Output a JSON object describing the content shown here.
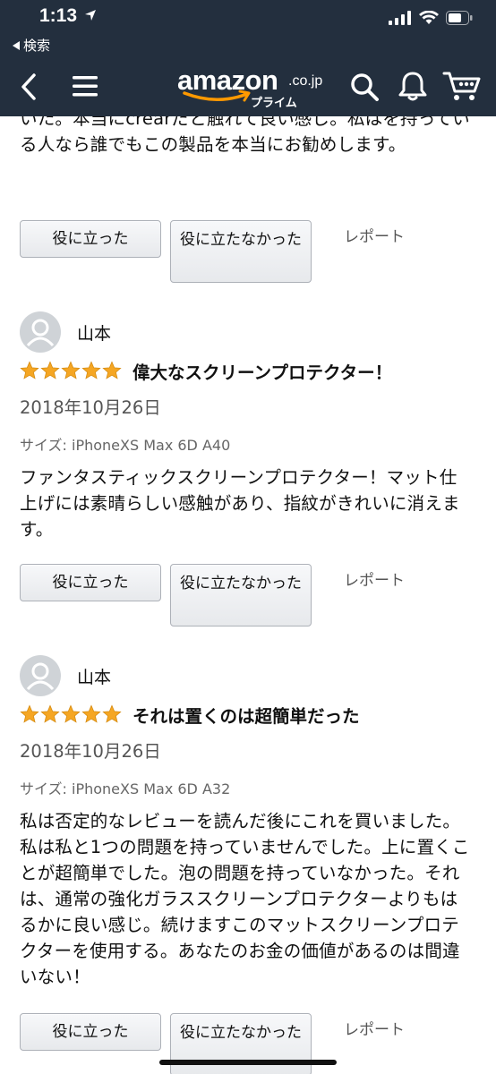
{
  "status_bar": {
    "time": "1:13",
    "back_app": "検索"
  },
  "header": {
    "logo_main": "amazon",
    "logo_domain": ".co.jp",
    "logo_sub": "プライム"
  },
  "top_review": {
    "body_tail": "いた。本当にcrearだと触れて良い感じ。私はを持っている人なら誰でもこの製品を本当にお勧めします。",
    "buttons": {
      "helpful": "役に立った",
      "not_helpful": "役に立たなかった",
      "report": "レポート"
    }
  },
  "reviews": [
    {
      "user": "山本",
      "rating": 5,
      "title": "偉大なスクリーンプロテクター！",
      "date": "2018年10月26日",
      "size": "サイズ: iPhoneXS Max 6D A40",
      "body": "ファンタスティックスクリーンプロテクター！マット仕上げには素晴らしい感触があり、指紋がきれいに消えます。",
      "buttons": {
        "helpful": "役に立った",
        "not_helpful": "役に立たなかった",
        "report": "レポート"
      }
    },
    {
      "user": "山本",
      "rating": 5,
      "title": "それは置くのは超簡単だった",
      "date": "2018年10月26日",
      "size": "サイズ: iPhoneXS Max 6D A32",
      "body": "私は否定的なレビューを読んだ後にこれを買いました。私は私と1つの問題を持っていませんでした。上に置くことが超簡単でした。泡の問題を持っていなかった。それは、通常の強化ガラススクリーンプロテクターよりもはるかに良い感じ。続けますこのマットスクリーンプロテクターを使用する。あなたのお金の価値があるのは間違いない！",
      "buttons": {
        "helpful": "役に立った",
        "not_helpful": "役に立たなかった",
        "report": "レポート"
      }
    }
  ],
  "colors": {
    "header_bg": "#232f3e",
    "star": "#f5a623",
    "logo_accent": "#ff9900"
  }
}
